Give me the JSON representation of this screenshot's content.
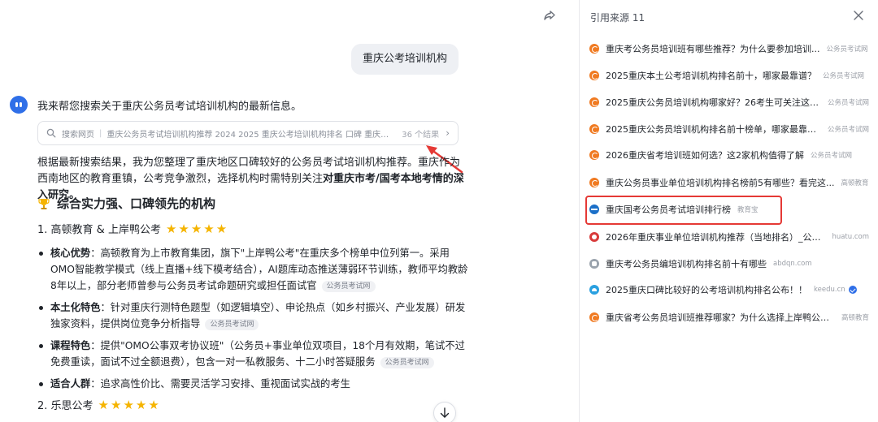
{
  "chat": {
    "user_message": "重庆公考培训机构",
    "intro": "我来帮您搜索关于重庆公务员考试培训机构的最新信息。",
    "search": {
      "label": "搜索网页",
      "query": "重庆公务员考试培训机构推荐 2024 2025 重庆公考培训机构排名 口碑 重庆国考...",
      "count": "36 个结果"
    },
    "summary_text": "根据最新搜索结果，我为您整理了重庆地区口碑较好的公务员考试培训机构推荐。重庆作为西南地区的教育重镇，公考竞争激烈，选择机构时需特别关注",
    "summary_bold": "对重庆市考/国考本地考情的深入研究。",
    "section_title": "综合实力强、口碑领先的机构",
    "items": [
      {
        "title": "1. 高顿教育 & 上岸鸭公考",
        "stars": "★★★★★",
        "rating": 5
      },
      {
        "title": "2. 乐思公考",
        "stars": "★★★★★",
        "rating": 5
      }
    ],
    "bullets": [
      {
        "label": "核心优势",
        "text": "：高顿教育为上市教育集团，旗下\"上岸鸭公考\"在重庆多个榜单中位列第一。采用OMO智能教学模式（线上直播+线下模考结合），AI题库动态推送薄弱环节训练，教师平均教龄8年以上，部分老师曾参与公务员考试命题研究或担任面试官",
        "tag": "公务员考试网"
      },
      {
        "label": "本土化特色",
        "text": "：针对重庆行测特色题型（如逻辑填空）、申论热点（如乡村振兴、产业发展）研发独家资料，提供岗位竞争分析指导",
        "tag": "公务员考试网"
      },
      {
        "label": "课程特色",
        "text": "：提供\"OMO公事双考协议班\"（公务员+事业单位双项目，18个月有效期，笔试不过免费重读，面试不过全额退费），包含一对一私教服务、十二小时答疑服务",
        "tag": "公务员考试网"
      },
      {
        "label": "适合人群",
        "text": "：追求高性价比、需要灵活学习安排、重视面试实战的考生",
        "tag": ""
      }
    ]
  },
  "sources_panel": {
    "title": "引用来源 11",
    "sources": [
      {
        "title": "重庆考公务员培训班有哪些推荐？为什么要参加培训...",
        "site": "公务员考试网",
        "icon": "orange-swirl-icon"
      },
      {
        "title": "2025重庆本土公考培训机构排名前十，哪家最靠谱？",
        "site": "公务员考试网",
        "icon": "orange-swirl-icon"
      },
      {
        "title": "2025重庆公务员培训机构哪家好？26考生可关注这5家",
        "site": "公务员考试网",
        "icon": "orange-swirl-icon"
      },
      {
        "title": "2025重庆公务员培训机构排名前十榜单，哪家最靠谱？",
        "site": "公务员考试网",
        "icon": "orange-swirl-icon"
      },
      {
        "title": "2026重庆省考培训班如何选？这2家机构值得了解",
        "site": "公务员考试网",
        "icon": "orange-swirl-icon"
      },
      {
        "title": "重庆公务员事业单位培训机构排名榜前5有哪些？看完这...",
        "site": "高顿教育",
        "icon": "orange-swirl-icon"
      },
      {
        "title": "重庆国考公务员考试培训排行榜",
        "site": "教育宝",
        "icon": "blue-globe-icon"
      },
      {
        "title": "2026年重庆事业单位培训机构推荐（当地排名）_公务...",
        "site": "huatu.com",
        "icon": "red-circle-icon"
      },
      {
        "title": "重庆考公务员编培训机构排名前十有哪些",
        "site": "abdqn.com",
        "icon": "gray-square-icon"
      },
      {
        "title": "2025重庆口碑比较好的公考培训机构排名公布！！",
        "site": "keedu.cn",
        "icon": "sky-cloud-icon"
      },
      {
        "title": "重庆省考公务员培训班推荐哪家？为什么选择上岸鸭公考...",
        "site": "高顿教育",
        "icon": "orange-swirl-icon"
      }
    ]
  },
  "colors": {
    "accent": "#2f6fe8",
    "star": "#f5b400",
    "annotation_red": "#e53935"
  }
}
